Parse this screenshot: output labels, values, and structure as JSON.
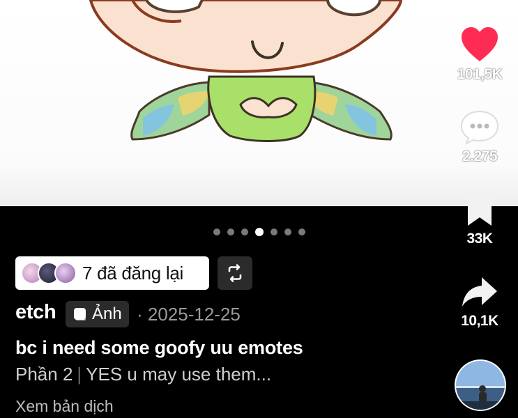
{
  "actions": {
    "like_count": "101,5K",
    "comment_count": "2.275",
    "save_count": "33K",
    "share_count": "10,1K"
  },
  "pager": {
    "total": 7,
    "active_index": 3
  },
  "repost": {
    "label": "7 đã đăng lại"
  },
  "post": {
    "author": "etch",
    "type_label": "Ảnh",
    "date": "· 2025-12-25",
    "caption": "bc i need some goofy uu emotes",
    "part": "Phần 2",
    "subcaption": "YES u may use them...",
    "translate": "Xem bản dịch"
  },
  "colors": {
    "like": "#fe2c55",
    "background": "#000000",
    "pill": "#ffffff",
    "chip": "#2b2b2b"
  },
  "icons": {
    "like": "heart-icon",
    "comment": "comment-bubble-icon",
    "save": "bookmark-icon",
    "share": "share-arrow-icon",
    "repost": "repost-icon",
    "photo_type": "photo-icon"
  }
}
